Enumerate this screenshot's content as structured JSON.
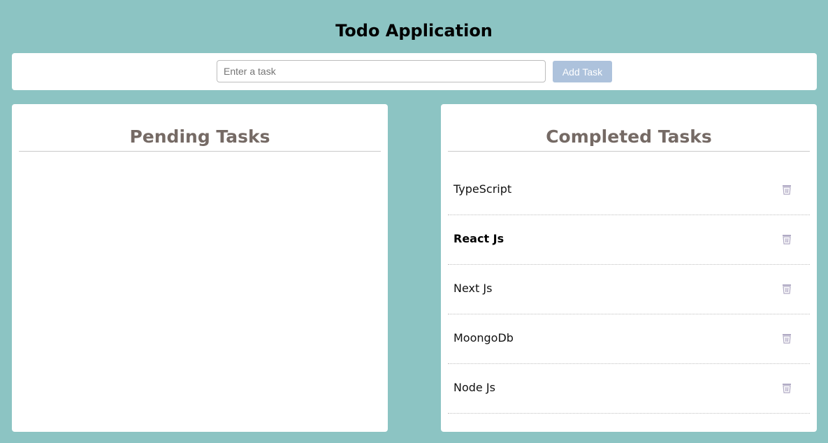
{
  "header": {
    "title": "Todo Application"
  },
  "input_bar": {
    "placeholder": "Enter a task",
    "value": "",
    "add_button_label": "Add Task"
  },
  "pending": {
    "title": "Pending Tasks",
    "items": []
  },
  "completed": {
    "title": "Completed Tasks",
    "items": [
      {
        "label": "TypeScript",
        "bold": false,
        "icon": "trash-icon"
      },
      {
        "label": "React Js",
        "bold": true,
        "icon": "trash-icon"
      },
      {
        "label": "Next Js",
        "bold": false,
        "icon": "trash-icon"
      },
      {
        "label": "MoongoDb",
        "bold": false,
        "icon": "trash-icon"
      },
      {
        "label": "Node Js",
        "bold": false,
        "icon": "trash-icon"
      }
    ]
  },
  "colors": {
    "background": "#8cc4c3",
    "panel_title": "#756a65",
    "add_button": "#adc2dc",
    "trash_icon": "#b0aac4"
  }
}
